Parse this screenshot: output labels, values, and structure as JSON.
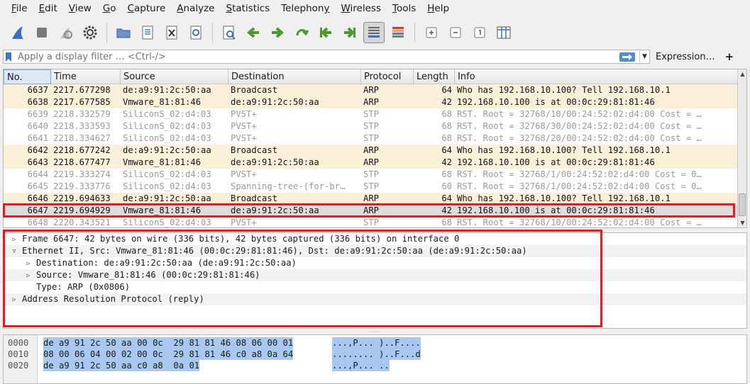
{
  "menu": [
    {
      "pre": "",
      "u": "F",
      "post": "ile"
    },
    {
      "pre": "",
      "u": "E",
      "post": "dit"
    },
    {
      "pre": "",
      "u": "V",
      "post": "iew"
    },
    {
      "pre": "",
      "u": "G",
      "post": "o"
    },
    {
      "pre": "",
      "u": "C",
      "post": "apture"
    },
    {
      "pre": "",
      "u": "A",
      "post": "nalyze"
    },
    {
      "pre": "",
      "u": "S",
      "post": "tatistics"
    },
    {
      "pre": "Telephon",
      "u": "y",
      "post": ""
    },
    {
      "pre": "",
      "u": "W",
      "post": "ireless"
    },
    {
      "pre": "",
      "u": "T",
      "post": "ools"
    },
    {
      "pre": "",
      "u": "H",
      "post": "elp"
    }
  ],
  "toolbar_icons": [
    "shark-fin-start-icon",
    "stop-capture-icon",
    "restart-capture-icon",
    "capture-options-gear-icon",
    "open-file-icon",
    "save-file-icon",
    "close-file-icon",
    "reload-file-icon",
    "find-packet-icon",
    "go-back-icon",
    "go-forward-icon",
    "go-to-packet-icon",
    "go-first-packet-icon",
    "go-last-packet-icon",
    "autoscroll-icon",
    "colorize-icon",
    "zoom-in-icon",
    "zoom-out-icon",
    "normal-size-icon",
    "resize-columns-icon"
  ],
  "filter": {
    "placeholder": "Apply a display filter … <Ctrl-/>",
    "expression_label": "Expression…",
    "plus_label": "+"
  },
  "columns": [
    "No.",
    "Time",
    "Source",
    "Destination",
    "Protocol",
    "Length",
    "Info"
  ],
  "packets": [
    {
      "no": "6637",
      "time": "2217.677298",
      "src": "de:a9:91:2c:50:aa",
      "dst": "Broadcast",
      "proto": "ARP",
      "len": "64",
      "info": "Who has 192.168.10.100? Tell 192.168.10.1",
      "kind": "arp"
    },
    {
      "no": "6638",
      "time": "2217.677585",
      "src": "Vmware_81:81:46",
      "dst": "de:a9:91:2c:50:aa",
      "proto": "ARP",
      "len": "42",
      "info": "192.168.10.100 is at 00:0c:29:81:81:46",
      "kind": "arp"
    },
    {
      "no": "6639",
      "time": "2218.332579",
      "src": "SiliconS_02:d4:03",
      "dst": "PVST+",
      "proto": "STP",
      "len": "68",
      "info": "RST. Root = 32768/10/00:24:52:02:d4:00  Cost = …",
      "kind": "stp"
    },
    {
      "no": "6640",
      "time": "2218.333593",
      "src": "SiliconS_02:d4:03",
      "dst": "PVST+",
      "proto": "STP",
      "len": "68",
      "info": "RST. Root = 32768/30/00:24:52:02:d4:00  Cost = …",
      "kind": "stp"
    },
    {
      "no": "6641",
      "time": "2218.334627",
      "src": "SiliconS_02:d4:03",
      "dst": "PVST+",
      "proto": "STP",
      "len": "68",
      "info": "RST. Root = 32768/20/00:24:52:02:d4:00  Cost = …",
      "kind": "stp"
    },
    {
      "no": "6642",
      "time": "2218.677242",
      "src": "de:a9:91:2c:50:aa",
      "dst": "Broadcast",
      "proto": "ARP",
      "len": "64",
      "info": "Who has 192.168.10.100? Tell 192.168.10.1",
      "kind": "arp"
    },
    {
      "no": "6643",
      "time": "2218.677477",
      "src": "Vmware_81:81:46",
      "dst": "de:a9:91:2c:50:aa",
      "proto": "ARP",
      "len": "42",
      "info": "192.168.10.100 is at 00:0c:29:81:81:46",
      "kind": "arp"
    },
    {
      "no": "6644",
      "time": "2219.333274",
      "src": "SiliconS_02:d4:03",
      "dst": "PVST+",
      "proto": "STP",
      "len": "68",
      "info": "RST. Root = 32768/1/00:24:52:02:d4:00  Cost = 0…",
      "kind": "stp"
    },
    {
      "no": "6645",
      "time": "2219.333776",
      "src": "SiliconS_02:d4:03",
      "dst": "Spanning-tree-(for-br…",
      "proto": "STP",
      "len": "60",
      "info": "RST. Root = 32768/1/00:24:52:02:d4:00  Cost = 0…",
      "kind": "stp"
    },
    {
      "no": "6646",
      "time": "2219.694633",
      "src": "de:a9:91:2c:50:aa",
      "dst": "Broadcast",
      "proto": "ARP",
      "len": "64",
      "info": "Who has 192.168.10.100? Tell 192.168.10.1",
      "kind": "arp"
    },
    {
      "no": "6647",
      "time": "2219.694929",
      "src": "Vmware_81:81:46",
      "dst": "de:a9:91:2c:50:aa",
      "proto": "ARP",
      "len": "42",
      "info": "192.168.10.100 is at 00:0c:29:81:81:46",
      "kind": "sel"
    },
    {
      "no": "6648",
      "time": "2220.343521",
      "src": "SiliconS_02:d4:03",
      "dst": "PVST+",
      "proto": "STP",
      "len": "68",
      "info": "RST. Root = 32768/10/00:24:52:02:d4:00  Cost = …",
      "kind": "stp"
    }
  ],
  "details": [
    {
      "indent": 0,
      "tri": "right",
      "text": "Frame 6647: 42 bytes on wire (336 bits), 42 bytes captured (336 bits) on interface 0"
    },
    {
      "indent": 0,
      "tri": "down",
      "text": "Ethernet II, Src: Vmware_81:81:46 (00:0c:29:81:81:46), Dst: de:a9:91:2c:50:aa (de:a9:91:2c:50:aa)"
    },
    {
      "indent": 1,
      "tri": "right",
      "text": "Destination: de:a9:91:2c:50:aa (de:a9:91:2c:50:aa)"
    },
    {
      "indent": 1,
      "tri": "right",
      "text": "Source: Vmware_81:81:46 (00:0c:29:81:81:46)"
    },
    {
      "indent": 1,
      "tri": "none",
      "text": "Type: ARP (0x0806)"
    },
    {
      "indent": 0,
      "tri": "right",
      "text": "Address Resolution Protocol (reply)"
    }
  ],
  "bytes": [
    {
      "off": "0000",
      "hex": "de a9 91 2c 50 aa 00 0c  29 81 81 46 08 06 00 01",
      "ascii": "...,P... )..F...."
    },
    {
      "off": "0010",
      "hex": "08 00 06 04 00 02 00 0c  29 81 81 46 c0 a8 0a 64",
      "ascii": "........ )..F...d"
    },
    {
      "off": "0020",
      "hex": "de a9 91 2c 50 aa c0 a8  0a 01",
      "ascii": "...,P... .."
    }
  ],
  "colors": {
    "arp_row": "#faf0d7",
    "stp_text": "#9a9a9a",
    "selected_row": "#dddddd",
    "annotation_red": "#e8191f",
    "byte_highlight": "#a9c8f0"
  }
}
